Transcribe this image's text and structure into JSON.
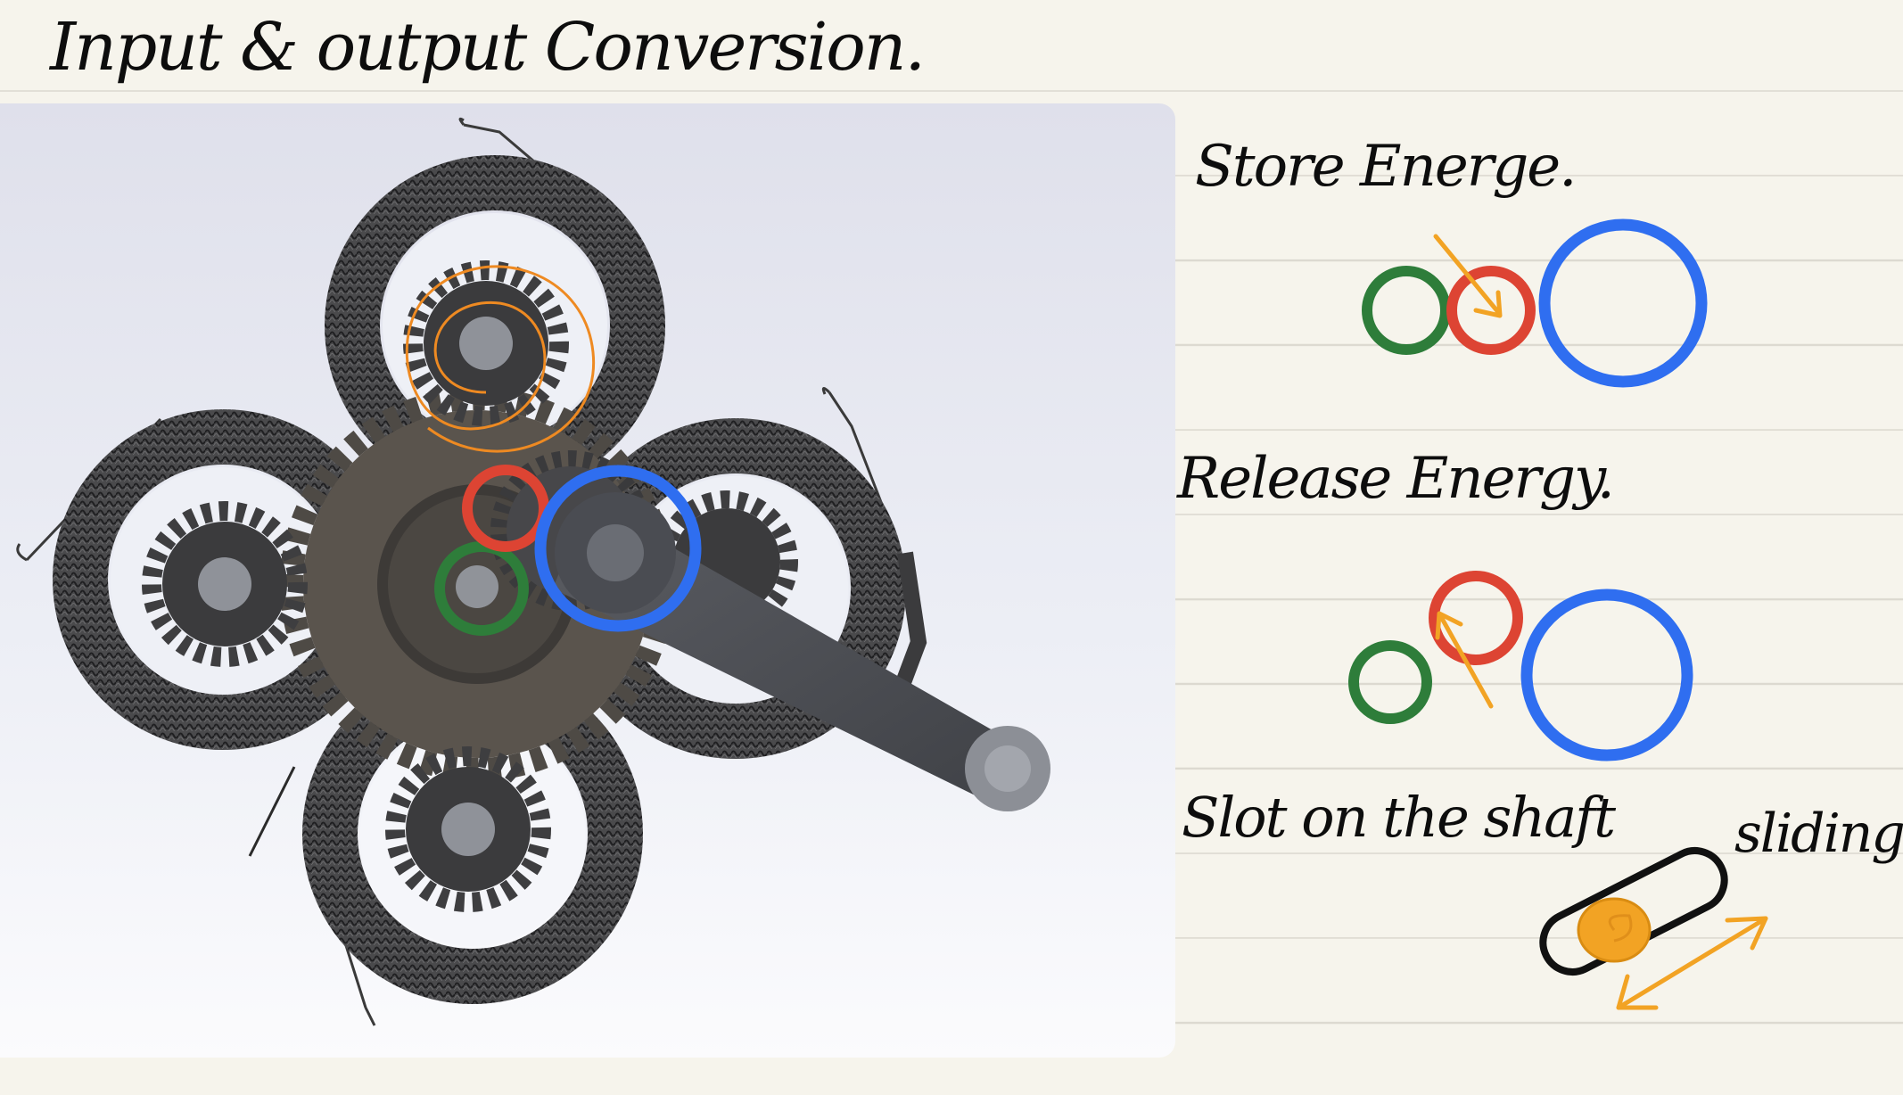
{
  "title": "Input & output Conversion.",
  "sections": {
    "store": {
      "label": "Store Energe."
    },
    "release": {
      "label": "Release Energy."
    },
    "slot": {
      "label": "Slot on the shaft",
      "note": "sliding."
    }
  },
  "colors": {
    "green_gear": "#2e7d3a",
    "red_gear": "#dd4433",
    "blue_gear": "#2f6ef0",
    "arrow": "#f2a324",
    "spring": "#ee8a22",
    "ink": "#111111"
  }
}
